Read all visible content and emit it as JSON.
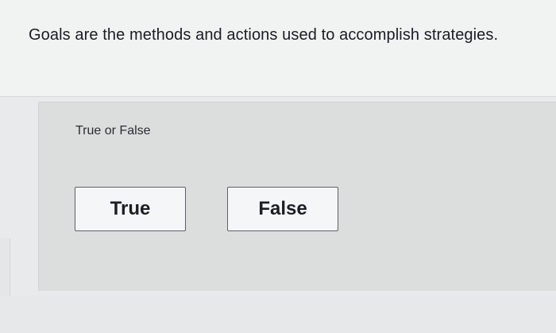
{
  "question": {
    "text": "Goals are the methods and actions used to accomplish strategies."
  },
  "answer": {
    "type_label": "True or False",
    "options": [
      {
        "label": "True"
      },
      {
        "label": "False"
      }
    ]
  }
}
